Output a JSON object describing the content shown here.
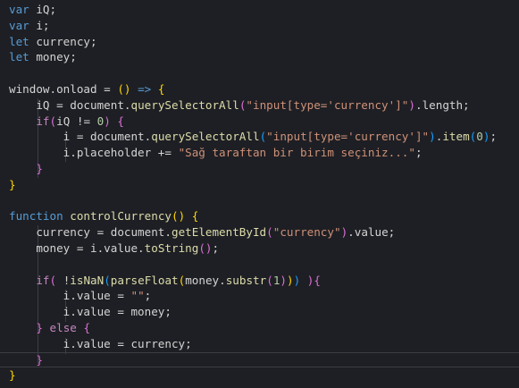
{
  "editor": {
    "theme_colors": {
      "background": "#1e1f24",
      "keyword": "#569cd6",
      "control": "#c586c0",
      "function": "#dcdcaa",
      "string": "#ce9178",
      "number": "#b5cea8",
      "bracket_level_1": "#ffd700",
      "bracket_level_2": "#da70d6",
      "bracket_level_3": "#179fff"
    },
    "lines": [
      [
        {
          "t": "var",
          "c": "kw"
        },
        {
          "t": " iQ;",
          "c": "var"
        }
      ],
      [
        {
          "t": "var",
          "c": "kw"
        },
        {
          "t": " i;",
          "c": "var"
        }
      ],
      [
        {
          "t": "let",
          "c": "kw"
        },
        {
          "t": " currency;",
          "c": "var"
        }
      ],
      [
        {
          "t": "let",
          "c": "kw"
        },
        {
          "t": " money;",
          "c": "var"
        }
      ],
      [],
      [
        {
          "t": "window.onload = ",
          "c": "var"
        },
        {
          "t": "()",
          "c": "p1"
        },
        {
          "t": " ",
          "c": "var"
        },
        {
          "t": "=>",
          "c": "kw"
        },
        {
          "t": " ",
          "c": "var"
        },
        {
          "t": "{",
          "c": "p1"
        }
      ],
      [
        {
          "t": "    iQ = document.",
          "c": "var"
        },
        {
          "t": "querySelectorAll",
          "c": "fn"
        },
        {
          "t": "(",
          "c": "p2"
        },
        {
          "t": "\"input[type='currency']\"",
          "c": "str"
        },
        {
          "t": ")",
          "c": "p2"
        },
        {
          "t": ".length;",
          "c": "var"
        }
      ],
      [
        {
          "t": "    ",
          "c": "var"
        },
        {
          "t": "if",
          "c": "ctrl"
        },
        {
          "t": "(",
          "c": "p2"
        },
        {
          "t": "iQ != ",
          "c": "var"
        },
        {
          "t": "0",
          "c": "num"
        },
        {
          "t": ")",
          "c": "p2"
        },
        {
          "t": " ",
          "c": "var"
        },
        {
          "t": "{",
          "c": "p2"
        }
      ],
      [
        {
          "t": "        i = document.",
          "c": "var"
        },
        {
          "t": "querySelectorAll",
          "c": "fn"
        },
        {
          "t": "(",
          "c": "p3"
        },
        {
          "t": "\"input[type='currency']\"",
          "c": "str"
        },
        {
          "t": ")",
          "c": "p3"
        },
        {
          "t": ".",
          "c": "var"
        },
        {
          "t": "item",
          "c": "fn"
        },
        {
          "t": "(",
          "c": "p3"
        },
        {
          "t": "0",
          "c": "num"
        },
        {
          "t": ")",
          "c": "p3"
        },
        {
          "t": ";",
          "c": "var"
        }
      ],
      [
        {
          "t": "        i.placeholder += ",
          "c": "var"
        },
        {
          "t": "\"Sağ taraftan bir birim seçiniz...\"",
          "c": "str"
        },
        {
          "t": ";",
          "c": "var"
        }
      ],
      [
        {
          "t": "    ",
          "c": "var"
        },
        {
          "t": "}",
          "c": "p2"
        }
      ],
      [
        {
          "t": "}",
          "c": "p1"
        }
      ],
      [],
      [
        {
          "t": "function",
          "c": "kw"
        },
        {
          "t": " ",
          "c": "var"
        },
        {
          "t": "controlCurrency",
          "c": "fn"
        },
        {
          "t": "()",
          "c": "p1"
        },
        {
          "t": " ",
          "c": "var"
        },
        {
          "t": "{",
          "c": "p1"
        }
      ],
      [
        {
          "t": "    currency = document.",
          "c": "var"
        },
        {
          "t": "getElementById",
          "c": "fn"
        },
        {
          "t": "(",
          "c": "p2"
        },
        {
          "t": "\"currency\"",
          "c": "str"
        },
        {
          "t": ")",
          "c": "p2"
        },
        {
          "t": ".value;",
          "c": "var"
        }
      ],
      [
        {
          "t": "    money = i.value.",
          "c": "var"
        },
        {
          "t": "toString",
          "c": "fn"
        },
        {
          "t": "()",
          "c": "p2"
        },
        {
          "t": ";",
          "c": "var"
        }
      ],
      [],
      [
        {
          "t": "    ",
          "c": "var"
        },
        {
          "t": "if",
          "c": "ctrl"
        },
        {
          "t": "(",
          "c": "p2"
        },
        {
          "t": " !",
          "c": "var"
        },
        {
          "t": "isNaN",
          "c": "fn"
        },
        {
          "t": "(",
          "c": "p3"
        },
        {
          "t": "parseFloat",
          "c": "fn"
        },
        {
          "t": "(",
          "c": "p1"
        },
        {
          "t": "money.",
          "c": "var"
        },
        {
          "t": "substr",
          "c": "fn"
        },
        {
          "t": "(",
          "c": "p2"
        },
        {
          "t": "1",
          "c": "num"
        },
        {
          "t": ")",
          "c": "p2"
        },
        {
          "t": ")",
          "c": "p1"
        },
        {
          "t": ")",
          "c": "p3"
        },
        {
          "t": " ",
          "c": "var"
        },
        {
          "t": ")",
          "c": "p2"
        },
        {
          "t": "{",
          "c": "p2"
        }
      ],
      [
        {
          "t": "        i.value = ",
          "c": "var"
        },
        {
          "t": "\"\"",
          "c": "str"
        },
        {
          "t": ";",
          "c": "var"
        }
      ],
      [
        {
          "t": "        i.value = money;",
          "c": "var"
        }
      ],
      [
        {
          "t": "    ",
          "c": "var"
        },
        {
          "t": "}",
          "c": "p2"
        },
        {
          "t": " ",
          "c": "var"
        },
        {
          "t": "else",
          "c": "ctrl"
        },
        {
          "t": " ",
          "c": "var"
        },
        {
          "t": "{",
          "c": "p2"
        }
      ],
      [
        {
          "t": "        i.value = currency;",
          "c": "var"
        }
      ],
      [
        {
          "t": "    ",
          "c": "var"
        },
        {
          "t": "}",
          "c": "p2"
        }
      ],
      [
        {
          "t": "}",
          "c": "p1"
        }
      ]
    ],
    "current_line_index": 22
  }
}
